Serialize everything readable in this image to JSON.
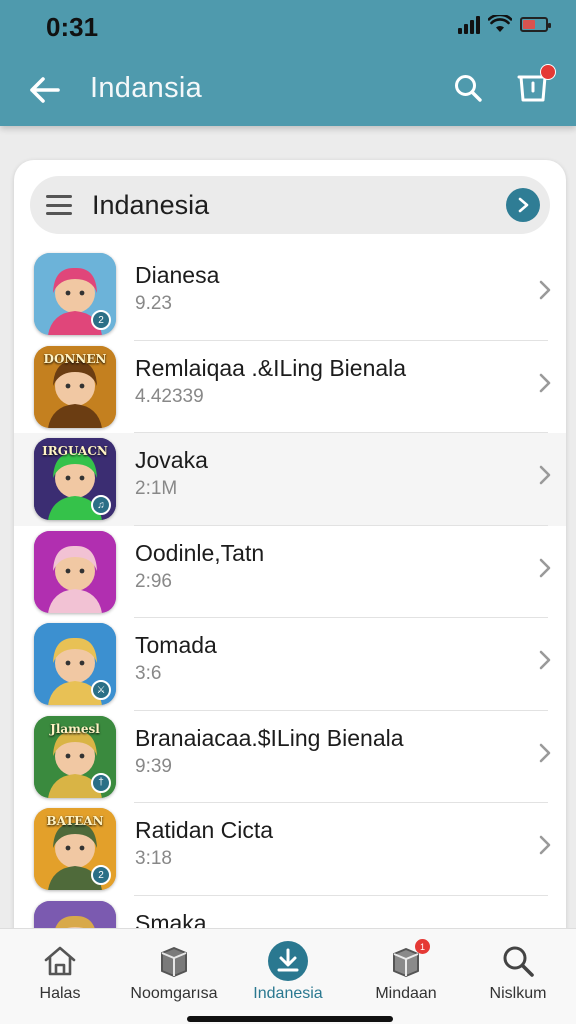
{
  "status_bar": {
    "time": "0:31"
  },
  "header": {
    "title": "Indansia",
    "cart_badge": ""
  },
  "search": {
    "value": "Indanesia"
  },
  "apps": [
    {
      "name": "Dianesa",
      "meta": "9.23",
      "icon_bg": "#6cb3d9",
      "icon_accent": "#e0467a",
      "icon_badge": "2"
    },
    {
      "name": "Remlaiqaa .&ILing Bienala",
      "meta": "4.42339",
      "icon_bg": "#c4801f",
      "icon_accent": "#6b3d12",
      "icon_badge": "",
      "icon_text": "DONNEN"
    },
    {
      "name": "Jovaka",
      "meta": "2:1M",
      "icon_bg": "#3b2d72",
      "icon_accent": "#35c24a",
      "icon_badge": "♫",
      "icon_text": "IRGUACN"
    },
    {
      "name": "Oodinle,Tatn",
      "meta": "2:96",
      "icon_bg": "#b12fb0",
      "icon_accent": "#f2c2d4",
      "icon_badge": ""
    },
    {
      "name": "Tomada",
      "meta": "3:6",
      "icon_bg": "#3c90d0",
      "icon_accent": "#e8c155",
      "icon_badge": "⚔"
    },
    {
      "name": "Branaiacaa.$ILing Bienala",
      "meta": "9:39",
      "icon_bg": "#3a8a3e",
      "icon_accent": "#d9b445",
      "icon_badge": "†",
      "icon_text": "Jlamesl"
    },
    {
      "name": "Ratidan Cicta",
      "meta": "3:18",
      "icon_bg": "#e3a02a",
      "icon_accent": "#4f6a3a",
      "icon_badge": "2",
      "icon_text": "BATEAN"
    },
    {
      "name": "Smaka",
      "meta": "",
      "icon_bg": "#7b5ab0",
      "icon_accent": "#d8a94a",
      "icon_badge": ""
    }
  ],
  "bottom_nav": [
    {
      "label": "Halas",
      "icon": "home-icon"
    },
    {
      "label": "Noomgarısa",
      "icon": "package-icon"
    },
    {
      "label": "Indanesia",
      "icon": "download-icon",
      "active": true
    },
    {
      "label": "Mindaan",
      "icon": "box-icon",
      "badge": "1"
    },
    {
      "label": "Nislkum",
      "icon": "search-icon"
    }
  ],
  "colors": {
    "app_bar": "#4f9aad",
    "accent": "#2f7d95",
    "badge": "#e53935"
  }
}
